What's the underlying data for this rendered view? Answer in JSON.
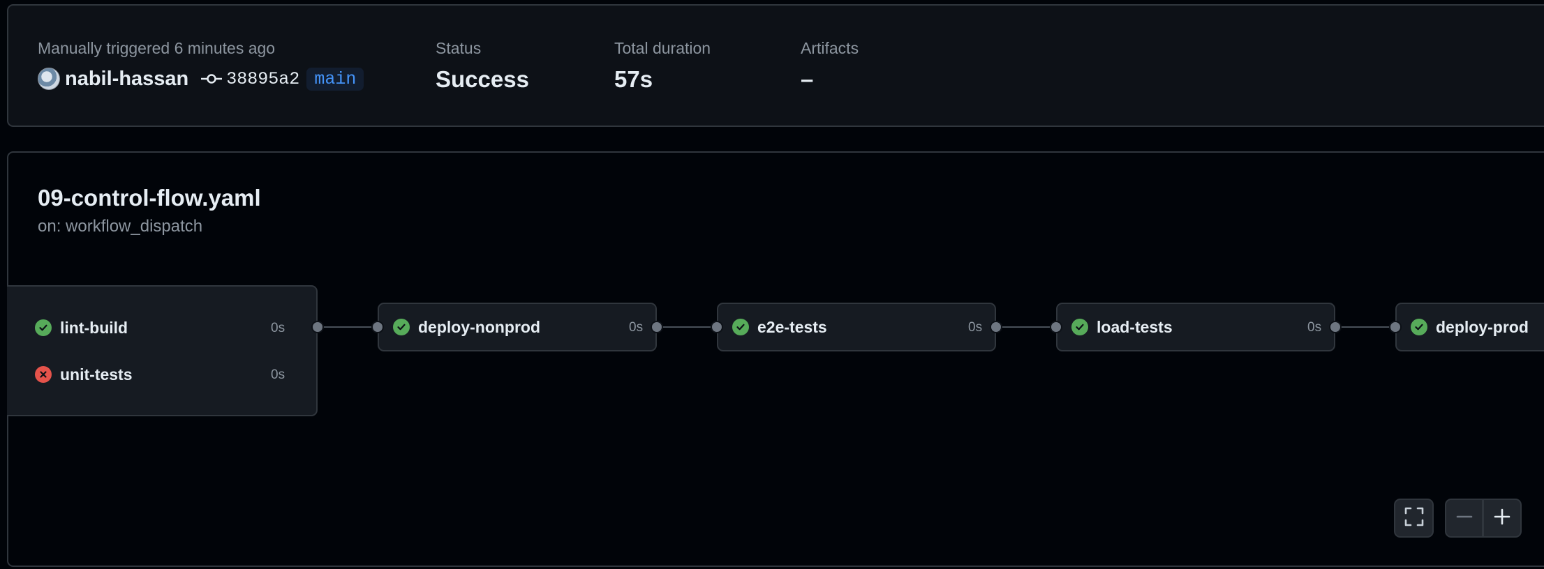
{
  "summary": {
    "trigger_text": "Manually triggered 6 minutes ago",
    "actor": "nabil-hassan",
    "commit_sha": "38895a2",
    "branch": "main",
    "status_label": "Status",
    "status_value": "Success",
    "duration_label": "Total duration",
    "duration_value": "57s",
    "artifacts_label": "Artifacts",
    "artifacts_value": "–"
  },
  "workflow": {
    "file_name": "09-control-flow.yaml",
    "trigger": "on: workflow_dispatch"
  },
  "jobs": [
    {
      "name": "lint-build",
      "duration": "0s",
      "status": "success"
    },
    {
      "name": "unit-tests",
      "duration": "0s",
      "status": "failure"
    },
    {
      "name": "deploy-nonprod",
      "duration": "0s",
      "status": "success"
    },
    {
      "name": "e2e-tests",
      "duration": "0s",
      "status": "success"
    },
    {
      "name": "load-tests",
      "duration": "0s",
      "status": "success"
    },
    {
      "name": "deploy-prod",
      "duration": "",
      "status": "success"
    }
  ],
  "controls": {
    "fullscreen_icon": "fullscreen-icon",
    "zoom_out_icon": "minus-icon",
    "zoom_in_icon": "plus-icon"
  },
  "colors": {
    "success": "#57ab5a",
    "failure": "#e5534b",
    "branch_text": "#4493f8",
    "background": "#010409"
  }
}
